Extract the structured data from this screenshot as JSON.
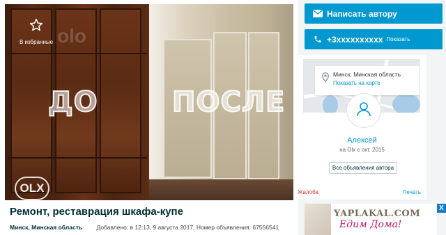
{
  "ad": {
    "favorite_label": "В избранные",
    "photo_before_label": "ДО",
    "photo_after_label": "ПОСЛЕ",
    "watermark": "olo",
    "logo": "OLX",
    "title": "Ремонт, реставрация шкафа-купе",
    "location": "Минск, Минская область",
    "meta": "Добавлено: в 12:13, 9 августа 2017, Номер объявления: 67556541"
  },
  "contact": {
    "message_button": "Написать автору",
    "phone_number": "+3xxxxxxxxxx",
    "phone_show": "Показать"
  },
  "seller": {
    "city": "Минск, Минская область",
    "show_on_map": "Показать на карте",
    "name": "Алексей",
    "since": "на Olx с окт. 2015",
    "all_ads": "Все объявления автора",
    "report": "Жалоба",
    "print": "Печать"
  },
  "banner": {
    "brand": "YAPLAKAL.COM",
    "slogan": "Едим Дома!",
    "close": "X"
  },
  "colors": {
    "accent": "#0098d0",
    "title": "#002f34",
    "report": "#d8342a",
    "slogan": "#c2185b"
  }
}
